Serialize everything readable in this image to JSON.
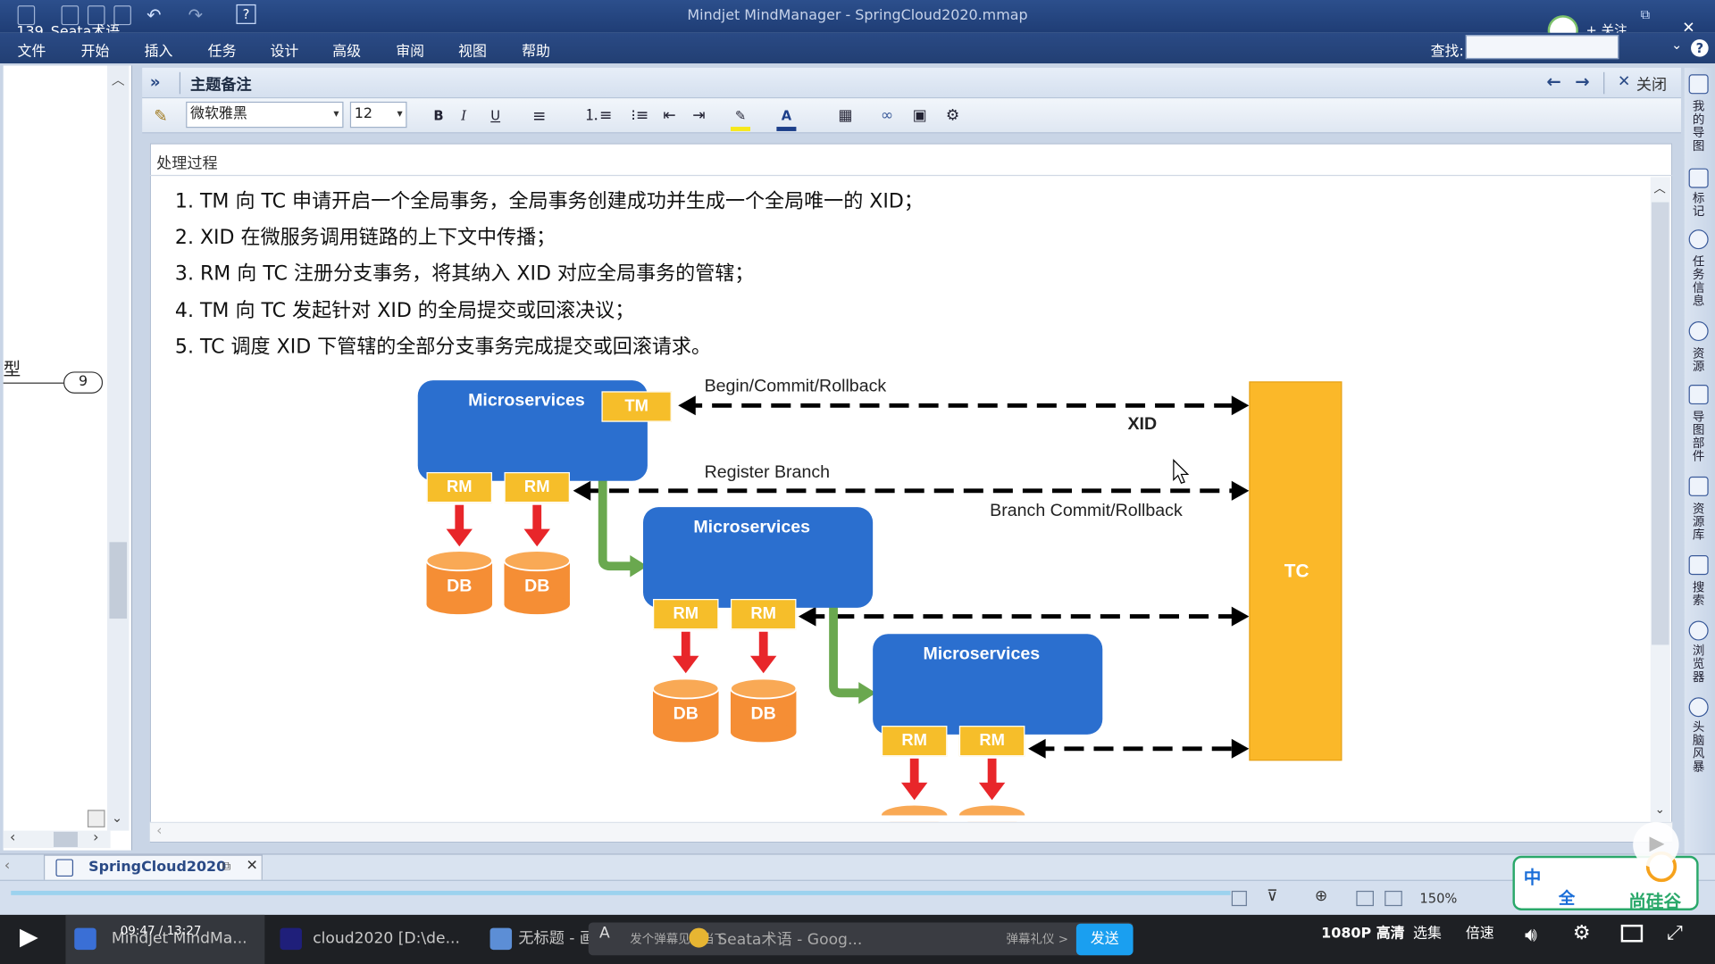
{
  "window": {
    "app_title": "Mindjet MindManager - SpringCloud2020.mmap",
    "video_title": "139_Seata术语",
    "follow_label": "+ 关注",
    "search_label": "查找:"
  },
  "menu": [
    "文件",
    "开始",
    "插入",
    "任务",
    "设计",
    "高级",
    "审阅",
    "视图",
    "帮助"
  ],
  "left_panel": {
    "partial_text": "型",
    "badge_count": "9"
  },
  "notes_panel": {
    "title": "主题备注",
    "close_label": "关闭",
    "font_name": "微软雅黑",
    "font_size": "12",
    "bold": "B",
    "italic": "I",
    "underline": "U"
  },
  "topic_title": "处理过程",
  "steps": [
    "1.  TM 向 TC 申请开启一个全局事务，全局事务创建成功并生成一个全局唯一的 XID；",
    "2.  XID 在微服务调用链路的上下文中传播；",
    "3.  RM 向 TC 注册分支事务，将其纳入 XID 对应全局事务的管辖；",
    "4.  TM 向 TC 发起针对 XID 的全局提交或回滚决议；",
    "5.  TC 调度 XID 下管辖的全部分支事务完成提交或回滚请求。"
  ],
  "diagram": {
    "microservices_label": "Microservices",
    "tm_label": "TM",
    "rm_label": "RM",
    "db_label": "DB",
    "tc_label": "TC",
    "begin_label": "Begin/Commit/Rollback",
    "xid_label": "XID",
    "register_label": "Register Branch",
    "branch_commit_label": "Branch Commit/Rollback",
    "colors": {
      "microservice": "#2b6fcf",
      "rm_tm": "#f6be2a",
      "tc": "#fbb829",
      "db": "#f58e35",
      "arrow_red": "#e8262a",
      "arrow_green": "#6aa84f"
    }
  },
  "doc_tab": {
    "label": "SpringCloud2020"
  },
  "status": {
    "zoom": "150%"
  },
  "taskbar": {
    "time": "09:47 / 13:27",
    "app1": "Mindjet MindMa...",
    "app2": "cloud2020 [D:\\de...",
    "app3": "无标题 - 画图",
    "app4": "Seata术语 - Goog...",
    "danmu_placeholder": "发个弹幕见证当下",
    "danmu_gift": "弹幕礼仪 >",
    "send": "发送",
    "quality": "1080P 高清",
    "episodes": "选集",
    "speed": "倍速"
  },
  "widget": {
    "ime": "中",
    "brand": "尚硅谷",
    "full": "全"
  }
}
